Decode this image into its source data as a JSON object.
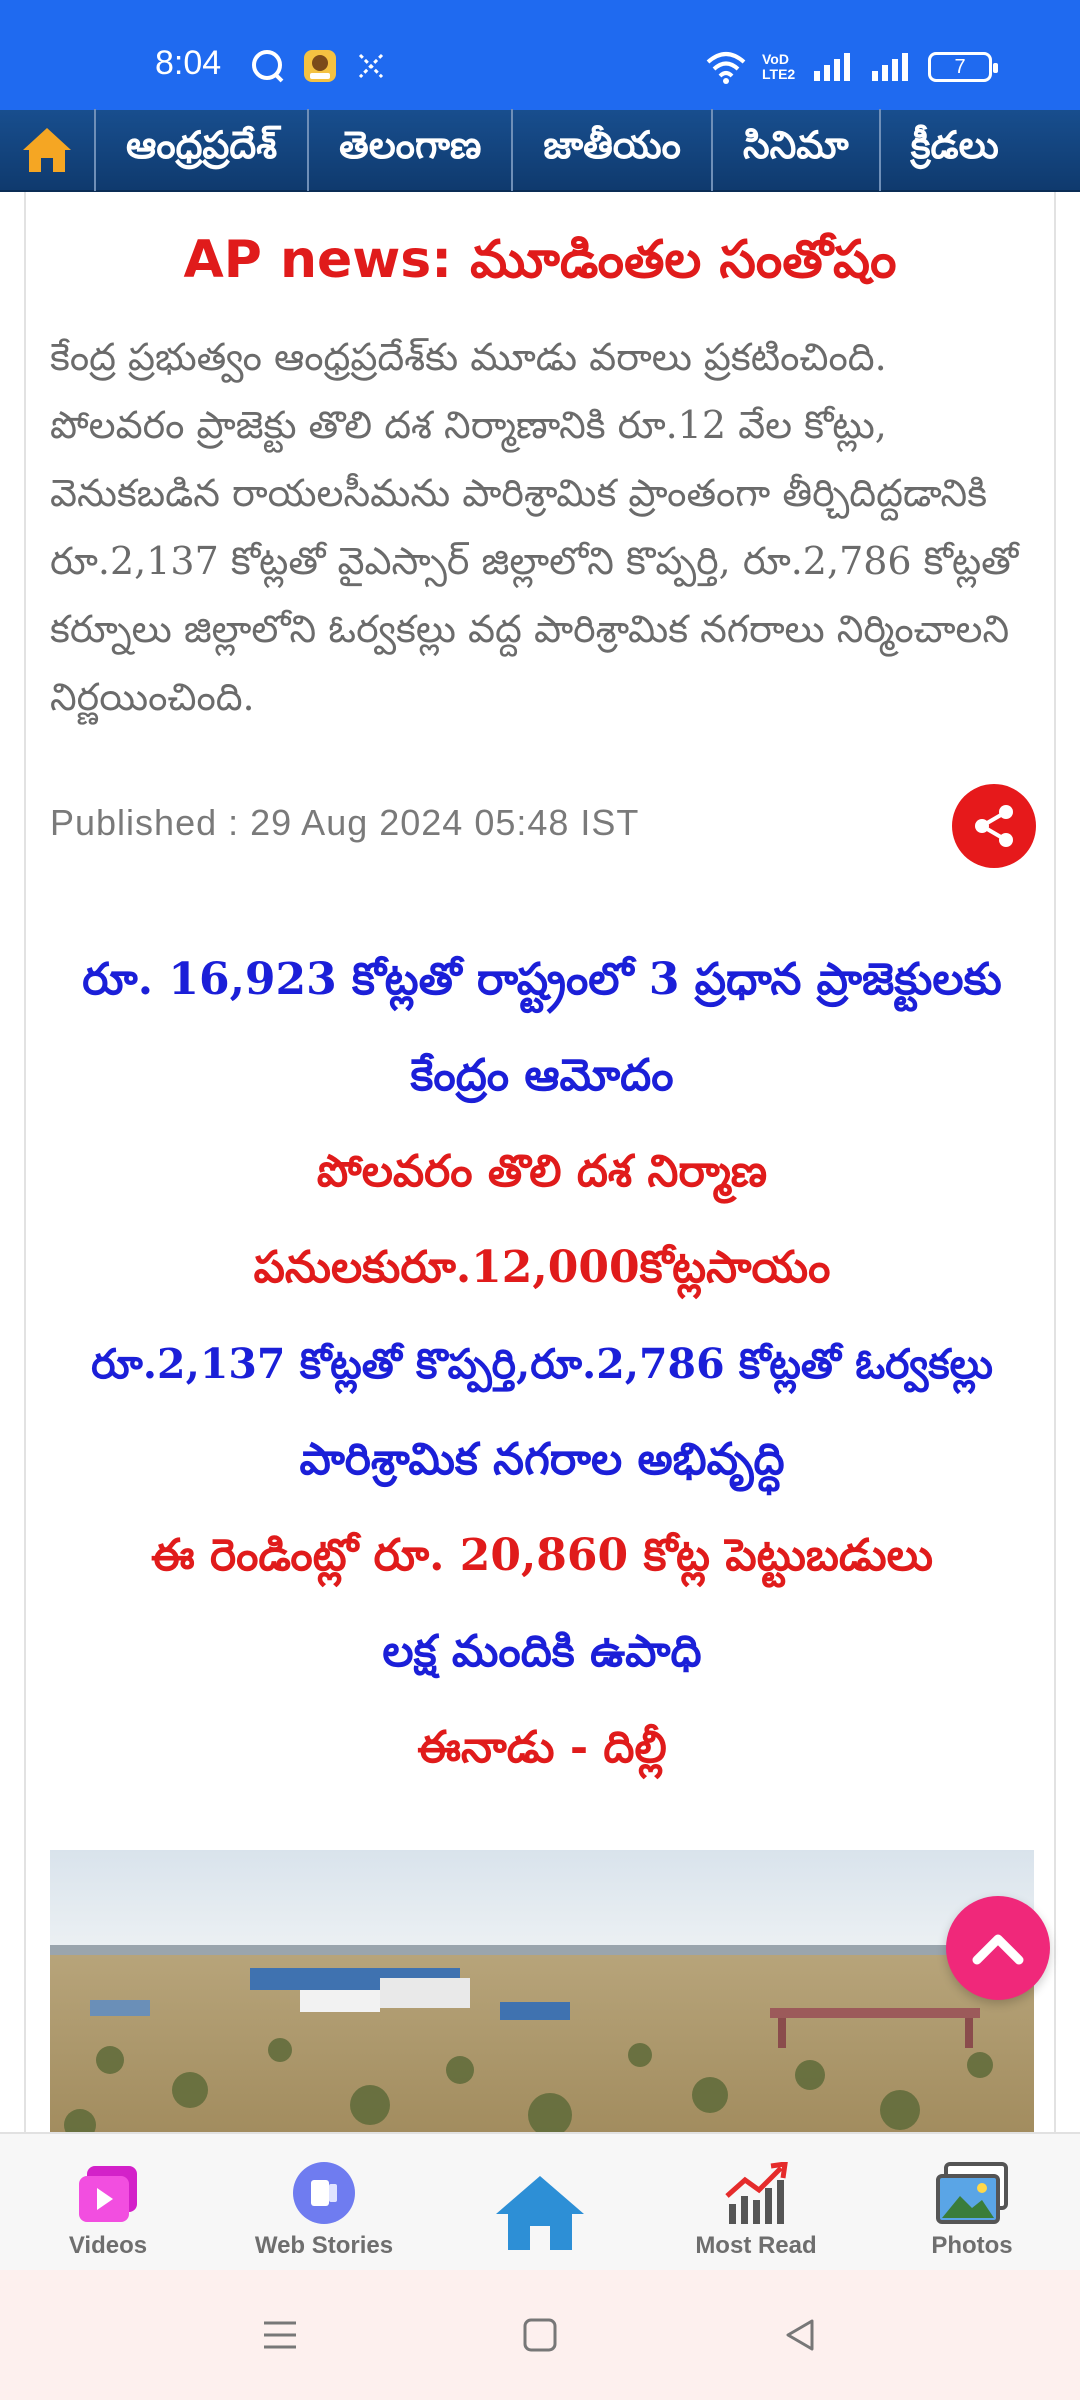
{
  "status_bar": {
    "time": "8:04",
    "volte_label": "VoD LTE2",
    "battery": "7"
  },
  "nav": {
    "tabs": [
      "ఆంధ్రప్రదేశ్",
      "తెలంగాణ",
      "జాతీయం",
      "సినిమా",
      "క్రీడలు"
    ]
  },
  "article": {
    "headline": "AP news: మూడింతల సంతోషం",
    "summary": "కేంద్ర ప్రభుత్వం ఆంధ్రప్రదేశ్‌కు మూడు వరాలు ప్రకటించింది. పోలవరం ప్రాజెక్టు తొలి దశ నిర్మాణానికి రూ.12 వేల కోట్లు, వెనుకబడిన రాయలసీమను పారిశ్రామిక ప్రాంతంగా తీర్చిదిద్దడానికి రూ.2,137 కోట్లతో వైఎస్సార్ జిల్లాలోని కొప్పర్తి, రూ.2,786 కోట్లతో కర్నూలు జిల్లాలోని ఓర్వకల్లు వద్ద పారిశ్రామిక నగరాలు నిర్మించాలని నిర్ణయించింది.",
    "published": "Published : 29 Aug 2024 05:48 IST",
    "body_lines": [
      {
        "text": "రూ. 16,923 కోట్లతో రాష్ట్రంలో 3 ప్రధాన ప్రాజెక్టులకు",
        "color": "blue"
      },
      {
        "text": "కేంద్రం ఆమోదం",
        "color": "blue"
      },
      {
        "text": "పోలవరం తొలి దశ నిర్మాణ",
        "color": "red"
      },
      {
        "text": "పనులకురూ.12,000కోట్లసాయం",
        "color": "red"
      },
      {
        "text": "రూ.2,137 కోట్లతో కొప్పర్తి,రూ.2,786 కోట్లతో ఓర్వకల్లు",
        "color": "blue"
      },
      {
        "text": "పారిశ్రామిక నగరాల అభివృద్ధి",
        "color": "blue"
      },
      {
        "text": "ఈ రెండింట్లో రూ. 20,860 కోట్ల పెట్టుబడులు",
        "color": "red"
      },
      {
        "text": "లక్ష మందికి ఉపాధి",
        "color": "blue"
      },
      {
        "text": "ఈనాడు - దిల్లీ",
        "color": "red"
      }
    ]
  },
  "bottom_nav": {
    "items": [
      {
        "label": "Videos",
        "icon": "videos-icon"
      },
      {
        "label": "Web Stories",
        "icon": "web-stories-icon"
      },
      {
        "label": "",
        "icon": "home-icon"
      },
      {
        "label": "Most Read",
        "icon": "most-read-icon"
      },
      {
        "label": "Photos",
        "icon": "photos-icon"
      }
    ]
  },
  "colors": {
    "status_bar": "#1f6af0",
    "nav_bar": "#184e8e",
    "headline_red": "#e01b1b",
    "body_blue": "#1b1fd8",
    "share": "#e6191b",
    "scroll_top": "#f0287a"
  }
}
